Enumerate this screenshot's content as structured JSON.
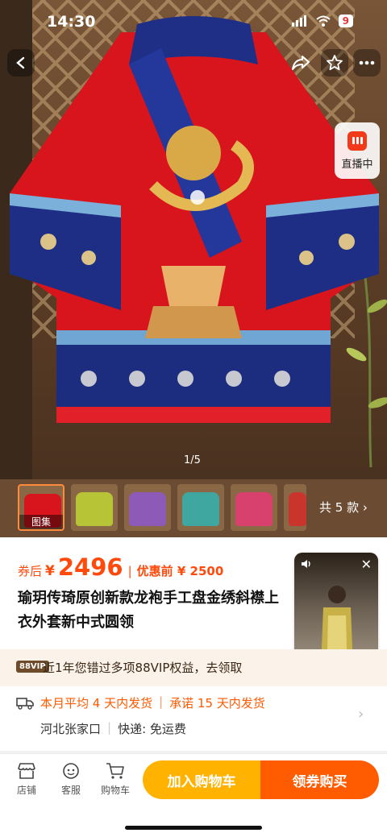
{
  "status_bar": {
    "time": "14:30",
    "battery": "9"
  },
  "hero": {
    "counter": "1/5",
    "live_label": "直播中"
  },
  "thumbnails": {
    "selected_tag": "图集",
    "variants_label": "共 5 款"
  },
  "price": {
    "coupon_label": "券后",
    "currency": "¥",
    "amount": "2496",
    "separator": "|",
    "orig_label": "优惠前 ¥ 2500"
  },
  "product": {
    "title": "瑜玥传琦原创新款龙袍手工盘金绣斜襟上衣外套新中式圆领"
  },
  "video": {
    "close": "✕"
  },
  "vip_banner": {
    "badge": "88VIP",
    "text": "近1年您错过多项88VIP权益，去领取"
  },
  "shipping": {
    "delivery": "本月平均 4 天内发货",
    "promise": "承诺 15 天内发货",
    "origin": "河北张家口",
    "express": "快递: 免运费"
  },
  "bottom_bar": {
    "shop": "店铺",
    "service": "客服",
    "cart": "购物车",
    "add_to_cart": "加入购物车",
    "buy_now": "领券购买"
  },
  "colors": {
    "accent": "#ff4a0b",
    "cart_button": "#ffb300",
    "buy_button": "#ff5b00"
  }
}
